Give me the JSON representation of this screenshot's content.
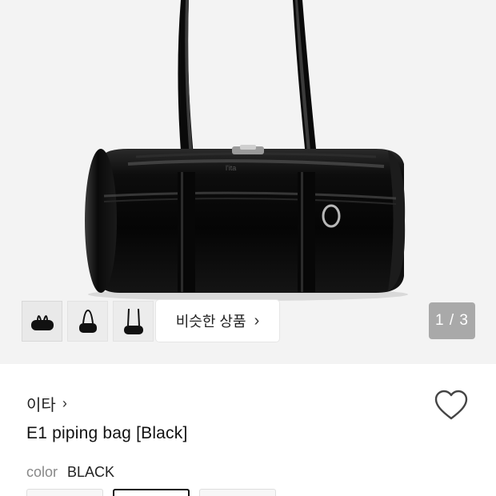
{
  "gallery": {
    "similar_label": "비슷한 상품",
    "page_indicator": "1 / 3",
    "thumbnails": [
      {
        "name": "front view"
      },
      {
        "name": "side view"
      },
      {
        "name": "worn view"
      }
    ]
  },
  "product": {
    "brand": "이타",
    "title": "E1 piping bag [Black]",
    "option_label": "color",
    "option_value": "BLACK"
  },
  "icons": {
    "brand_chevron": "chevron-right-icon",
    "similar_chevron": "chevron-right-icon",
    "like": "heart-icon"
  },
  "colors": {
    "hero_bg": "#f3f3f3",
    "indicator_bg": "#a9a9a9",
    "bag": "#0b0b0b"
  }
}
